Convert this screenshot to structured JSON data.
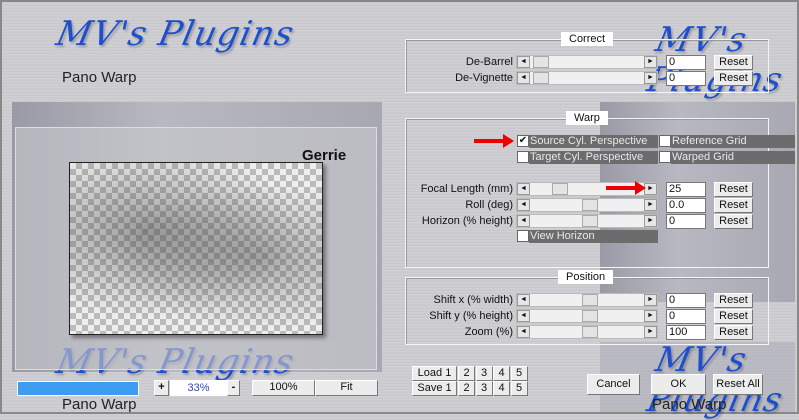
{
  "logo": {
    "text": "MV's Plugins",
    "subtitle": "Pano Warp"
  },
  "preview": {
    "image_label": "Gerrie",
    "zoom": "33%",
    "zoom_in": "+",
    "zoom_out": "-",
    "btn_100": "100%",
    "btn_fit": "Fit",
    "progress": 1.0
  },
  "correct": {
    "title": "Correct",
    "rows": [
      {
        "label": "De-Barrel",
        "value": "0",
        "reset": "Reset"
      },
      {
        "label": "De-Vignette",
        "value": "0",
        "reset": "Reset"
      }
    ]
  },
  "warp": {
    "title": "Warp",
    "checkboxes": [
      {
        "label": "Source Cyl. Perspective",
        "checked": true
      },
      {
        "label": "Reference Grid",
        "checked": false
      },
      {
        "label": "Target Cyl. Perspective",
        "checked": false
      },
      {
        "label": "Warped Grid",
        "checked": false
      }
    ],
    "rows": [
      {
        "label": "Focal Length (mm)",
        "value": "25",
        "reset": "Reset"
      },
      {
        "label": "Roll (deg)",
        "value": "0.0",
        "reset": "Reset"
      },
      {
        "label": "Horizon (% height)",
        "value": "0",
        "reset": "Reset"
      }
    ],
    "view_horizon": "View Horizon"
  },
  "position": {
    "title": "Position",
    "rows": [
      {
        "label": "Shift x (% width)",
        "value": "0",
        "reset": "Reset"
      },
      {
        "label": "Shift y (% height)",
        "value": "0",
        "reset": "Reset"
      },
      {
        "label": "Zoom (%)",
        "value": "100",
        "reset": "Reset"
      }
    ]
  },
  "presets": {
    "load": "Load 1",
    "save": "Save 1",
    "slots": [
      "2",
      "3",
      "4",
      "5"
    ]
  },
  "actions": {
    "cancel": "Cancel",
    "ok": "OK",
    "reset_all": "Reset All"
  },
  "check_mark": "✔"
}
